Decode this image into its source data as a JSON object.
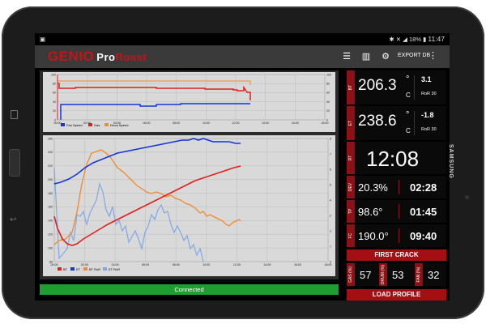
{
  "status": {
    "left_icon": "image-icon",
    "battery": "18%",
    "time": "11:47"
  },
  "app": {
    "logo_main": "GENIO",
    "logo_pro": "Pro",
    "logo_roast": "Roast",
    "export_label": "EXPORT DB"
  },
  "top_chart": {
    "legend": [
      "Fan Speed",
      "Gas",
      "Drum Speed"
    ],
    "x_ticks": [
      "00:00",
      "02:00",
      "04:00",
      "06:00",
      "08:00",
      "10:00",
      "12:00",
      "14:00",
      "16:00",
      "18:00"
    ],
    "y_left_ticks": [
      "100",
      "80",
      "60",
      "40",
      "20",
      "0"
    ],
    "y_right_ticks": [
      "100",
      "80",
      "60",
      "40",
      "20",
      "0"
    ]
  },
  "main_chart": {
    "legend": [
      "BT",
      "ET",
      "BT RoR",
      "ET RoR"
    ],
    "x_ticks": [
      "00:00",
      "02:00",
      "04:00",
      "06:00",
      "08:00",
      "10:00",
      "12:00",
      "14:00",
      "16:00",
      "18:00"
    ],
    "y_left_ticks": [
      "260",
      "240",
      "220",
      "200",
      "180",
      "160",
      "140",
      "120",
      "100",
      "80"
    ],
    "y_right_ticks": [
      "8",
      "7",
      "6",
      "5",
      "4",
      "3",
      "2",
      "1",
      "0"
    ]
  },
  "tiles": {
    "bt": {
      "tag": "BT",
      "value": "206.3",
      "deg": "°",
      "unit": "C",
      "ror": "3.1",
      "ror_label": "RoR 30"
    },
    "et": {
      "tag": "ET",
      "value": "238.6",
      "deg": "°",
      "unit": "C",
      "ror": "-1.8",
      "ror_label": "RoR 30"
    },
    "rt": {
      "tag": "RT",
      "value": "12:08"
    },
    "dev": {
      "tag": "DEV",
      "value": "20.3%",
      "time": "02:28"
    },
    "tp": {
      "tag": "TP",
      "value": "98.6°",
      "time": "01:45"
    },
    "fc": {
      "tag": "FC",
      "value": "190.0°",
      "time": "09:40"
    },
    "first_crack": "FIRST CRACK",
    "gas": {
      "tag": "GAS (%)",
      "value": "57"
    },
    "drum": {
      "tag": "DRUM (%)",
      "value": "53"
    },
    "fan": {
      "tag": "FAN (%)",
      "value": "32"
    },
    "load_profile": "LOAD PROFILE"
  },
  "connection": "Connected",
  "brand": "SAMSUNG",
  "colors": {
    "accent_red": "#a40f14",
    "connected_green": "#1e9e2f",
    "bt_red": "#e0201b",
    "et_blue": "#1236d6",
    "orange": "#f08a2c",
    "light_blue": "#7fa8e8"
  }
}
